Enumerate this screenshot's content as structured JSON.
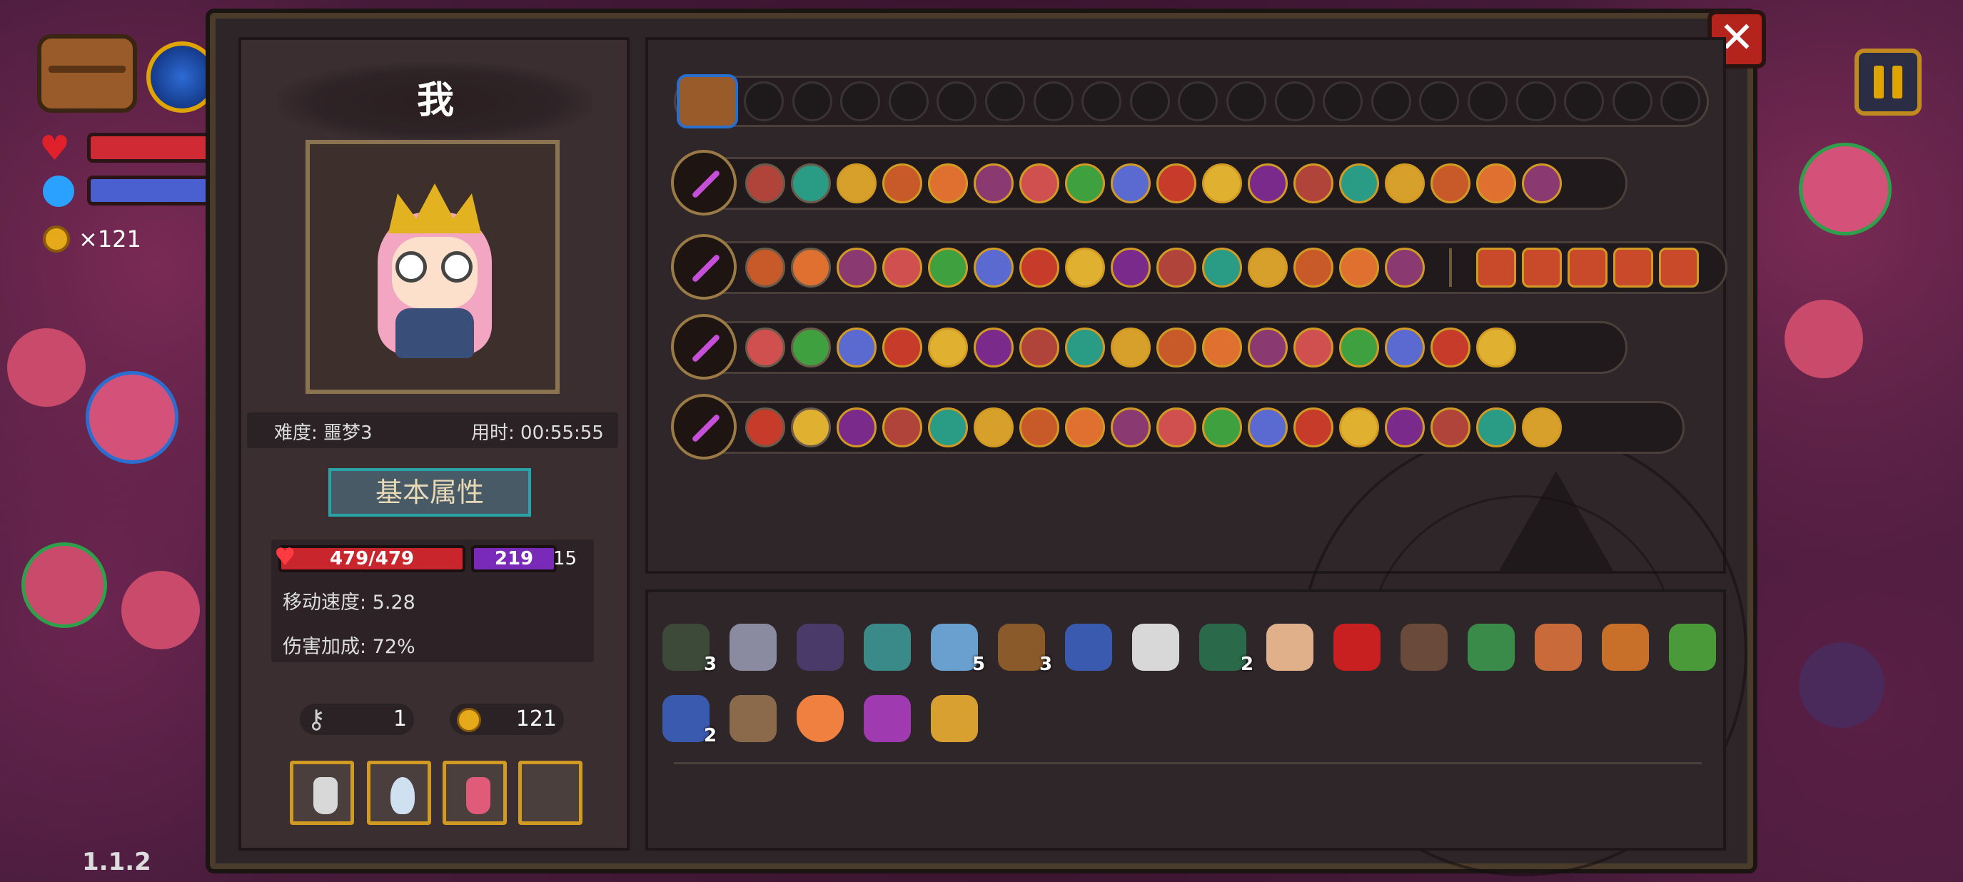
{
  "hud": {
    "coin_count": "×121",
    "version": "1.1.2"
  },
  "panel": {
    "close_label": "✕"
  },
  "player": {
    "name": "我",
    "difficulty": "难度: 噩梦3",
    "playtime": "用时: 00:55:55"
  },
  "attributes": {
    "title": "基本属性",
    "hp": "479/479",
    "shield": "219",
    "shield_extra": "15",
    "move_speed": "移动速度: 5.28",
    "damage_bonus": "伤害加成: 72%"
  },
  "resources": {
    "keys": "1",
    "coins": "121"
  },
  "colors": {
    "gold_border": "#d19a22",
    "blue_border": "#2a6fd0",
    "hp_red": "#c8252c",
    "shield_purple": "#7a2ab8",
    "accent_teal": "#2aa3a8"
  },
  "items": [
    {
      "name": "cloak",
      "count": "3"
    },
    {
      "name": "claw",
      "count": ""
    },
    {
      "name": "cape",
      "count": ""
    },
    {
      "name": "dice",
      "count": ""
    },
    {
      "name": "slime",
      "count": "5"
    },
    {
      "name": "pickaxe",
      "count": "3"
    },
    {
      "name": "orb-stand",
      "count": ""
    },
    {
      "name": "glasses",
      "count": ""
    },
    {
      "name": "bandana",
      "count": "2"
    },
    {
      "name": "ear",
      "count": ""
    },
    {
      "name": "red-eye",
      "count": ""
    },
    {
      "name": "armor",
      "count": ""
    },
    {
      "name": "helmet",
      "count": ""
    },
    {
      "name": "arrow",
      "count": ""
    },
    {
      "name": "gauntlet",
      "count": ""
    },
    {
      "name": "amulet",
      "count": ""
    },
    {
      "name": "glove",
      "count": "2"
    },
    {
      "name": "tablet",
      "count": ""
    },
    {
      "name": "heart",
      "count": ""
    },
    {
      "name": "scarf",
      "count": ""
    },
    {
      "name": "leaf",
      "count": ""
    }
  ]
}
